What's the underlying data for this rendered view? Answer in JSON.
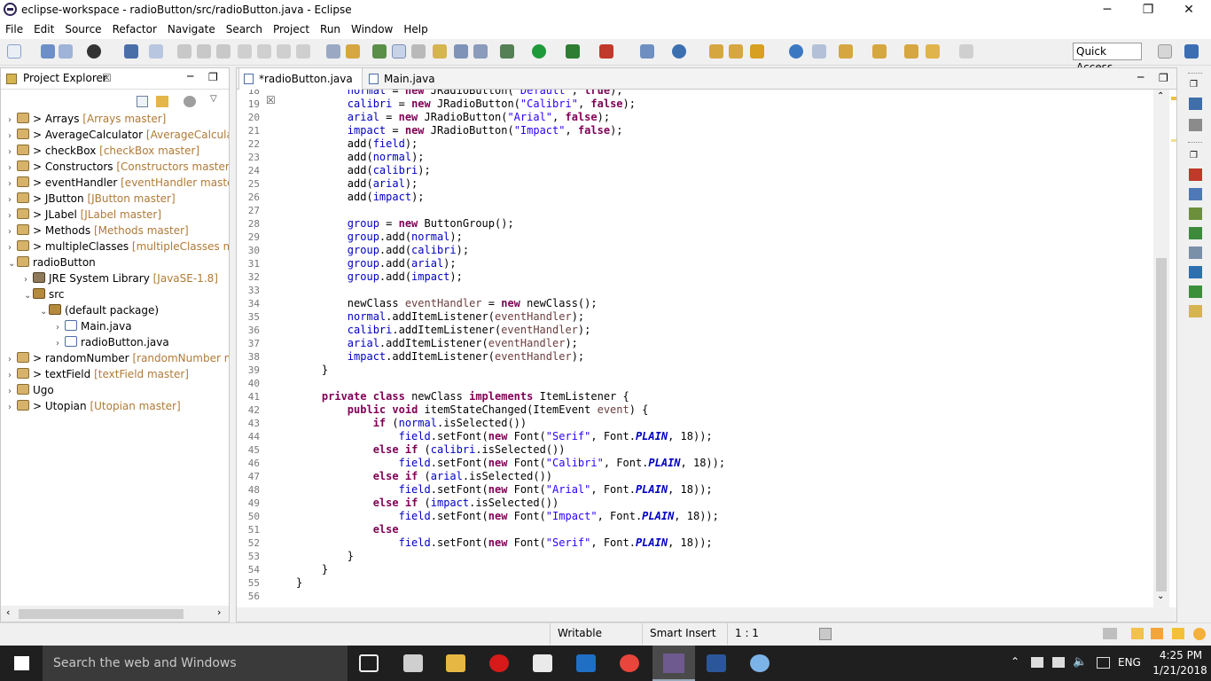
{
  "window": {
    "title": "eclipse-workspace - radioButton/src/radioButton.java - Eclipse",
    "minimize": "─",
    "maximize": "❐",
    "close": "✕"
  },
  "menu": [
    "File",
    "Edit",
    "Source",
    "Refactor",
    "Navigate",
    "Search",
    "Project",
    "Run",
    "Window",
    "Help"
  ],
  "quick_access": "Quick Access",
  "project_explorer": {
    "title": "Project Explorer",
    "tab_close": "☒",
    "items": [
      {
        "name": "> Arrays",
        "repo": "[Arrays master]",
        "depth": 0,
        "arrow": "›",
        "icon": "proj"
      },
      {
        "name": "> AverageCalculator",
        "repo": "[AverageCalculator",
        "depth": 0,
        "arrow": "›",
        "icon": "proj"
      },
      {
        "name": "> checkBox",
        "repo": "[checkBox master]",
        "depth": 0,
        "arrow": "›",
        "icon": "proj"
      },
      {
        "name": "> Constructors",
        "repo": "[Constructors master]",
        "depth": 0,
        "arrow": "›",
        "icon": "proj"
      },
      {
        "name": "> eventHandler",
        "repo": "[eventHandler master]",
        "depth": 0,
        "arrow": "›",
        "icon": "proj"
      },
      {
        "name": "> JButton",
        "repo": "[JButton master]",
        "depth": 0,
        "arrow": "›",
        "icon": "proj"
      },
      {
        "name": "> JLabel",
        "repo": "[JLabel master]",
        "depth": 0,
        "arrow": "›",
        "icon": "proj"
      },
      {
        "name": "> Methods",
        "repo": "[Methods master]",
        "depth": 0,
        "arrow": "›",
        "icon": "proj"
      },
      {
        "name": "> multipleClasses",
        "repo": "[multipleClasses mast",
        "depth": 0,
        "arrow": "›",
        "icon": "proj"
      },
      {
        "name": "radioButton",
        "repo": "",
        "depth": 0,
        "arrow": "⌄",
        "icon": "proj"
      },
      {
        "name": "JRE System Library",
        "repo": "[JavaSE-1.8]",
        "depth": 1,
        "arrow": "›",
        "icon": "lib"
      },
      {
        "name": "src",
        "repo": "",
        "depth": 1,
        "arrow": "⌄",
        "icon": "pkg"
      },
      {
        "name": "(default package)",
        "repo": "",
        "depth": 2,
        "arrow": "⌄",
        "icon": "pkg"
      },
      {
        "name": "Main.java",
        "repo": "",
        "depth": 3,
        "arrow": "›",
        "icon": "jfile"
      },
      {
        "name": "radioButton.java",
        "repo": "",
        "depth": 3,
        "arrow": "›",
        "icon": "jfile"
      },
      {
        "name": "> randomNumber",
        "repo": "[randomNumber ma",
        "depth": 0,
        "arrow": "›",
        "icon": "proj"
      },
      {
        "name": "> textField",
        "repo": "[textField master]",
        "depth": 0,
        "arrow": "›",
        "icon": "proj"
      },
      {
        "name": "Ugo",
        "repo": "",
        "depth": 0,
        "arrow": "›",
        "icon": "proj"
      },
      {
        "name": "> Utopian",
        "repo": "[Utopian master]",
        "depth": 0,
        "arrow": "›",
        "icon": "proj"
      }
    ]
  },
  "editor": {
    "tabs": [
      {
        "label": "*radioButton.java",
        "close": "☒"
      },
      {
        "label": "Main.java"
      }
    ],
    "lines": [
      {
        "n": "18",
        "h": "        <span class='fd'>normal</span> = <span class='kw'>new</span> JRadioButton(<span class='st'>\"Default\"</span>, <span class='kw'>true</span>);"
      },
      {
        "n": "19",
        "h": "        <span class='fd'>calibri</span> = <span class='kw'>new</span> JRadioButton(<span class='st'>\"Calibri\"</span>, <span class='kw'>false</span>);"
      },
      {
        "n": "20",
        "h": "        <span class='fd'>arial</span> = <span class='kw'>new</span> JRadioButton(<span class='st'>\"Arial\"</span>, <span class='kw'>false</span>);"
      },
      {
        "n": "21",
        "h": "        <span class='fd'>impact</span> = <span class='kw'>new</span> JRadioButton(<span class='st'>\"Impact\"</span>, <span class='kw'>false</span>);"
      },
      {
        "n": "22",
        "h": "        add(<span class='fd'>field</span>);"
      },
      {
        "n": "23",
        "h": "        add(<span class='fd'>normal</span>);"
      },
      {
        "n": "24",
        "h": "        add(<span class='fd'>calibri</span>);"
      },
      {
        "n": "25",
        "h": "        add(<span class='fd'>arial</span>);"
      },
      {
        "n": "26",
        "h": "        add(<span class='fd'>impact</span>);"
      },
      {
        "n": "27",
        "h": ""
      },
      {
        "n": "28",
        "h": "        <span class='fd'>group</span> = <span class='kw'>new</span> ButtonGroup();"
      },
      {
        "n": "29",
        "h": "        <span class='fd'>group</span>.add(<span class='fd'>normal</span>);"
      },
      {
        "n": "30",
        "h": "        <span class='fd'>group</span>.add(<span class='fd'>calibri</span>);"
      },
      {
        "n": "31",
        "h": "        <span class='fd'>group</span>.add(<span class='fd'>arial</span>);"
      },
      {
        "n": "32",
        "h": "        <span class='fd'>group</span>.add(<span class='fd'>impact</span>);"
      },
      {
        "n": "33",
        "h": ""
      },
      {
        "n": "34",
        "h": "        newClass <span class='vr'>eventHandler</span> = <span class='kw'>new</span> newClass();"
      },
      {
        "n": "35",
        "h": "        <span class='fd'>normal</span>.addItemListener(<span class='vr'>eventHandler</span>);"
      },
      {
        "n": "36",
        "h": "        <span class='fd'>calibri</span>.addItemListener(<span class='vr'>eventHandler</span>);"
      },
      {
        "n": "37",
        "h": "        <span class='fd'>arial</span>.addItemListener(<span class='vr'>eventHandler</span>);"
      },
      {
        "n": "38",
        "h": "        <span class='fd'>impact</span>.addItemListener(<span class='vr'>eventHandler</span>);"
      },
      {
        "n": "39",
        "h": "    }"
      },
      {
        "n": "40",
        "h": ""
      },
      {
        "n": "41",
        "h": "    <span class='kw'>private</span> <span class='kw'>class</span> newClass <span class='kw'>implements</span> ItemListener {"
      },
      {
        "n": "42",
        "h": "        <span class='kw'>public</span> <span class='kw'>void</span> itemStateChanged(ItemEvent <span class='vr'>event</span>) {"
      },
      {
        "n": "43",
        "h": "            <span class='kw'>if</span> (<span class='fd'>normal</span>.isSelected())"
      },
      {
        "n": "44",
        "h": "                <span class='fd'>field</span>.setFont(<span class='kw'>new</span> Font(<span class='st'>\"Serif\"</span>, Font.<span class='it'>PLAIN</span>, 18));"
      },
      {
        "n": "45",
        "h": "            <span class='kw'>else</span> <span class='kw'>if</span> (<span class='fd'>calibri</span>.isSelected())"
      },
      {
        "n": "46",
        "h": "                <span class='fd'>field</span>.setFont(<span class='kw'>new</span> Font(<span class='st'>\"Calibri\"</span>, Font.<span class='it'>PLAIN</span>, 18));"
      },
      {
        "n": "47",
        "h": "            <span class='kw'>else</span> <span class='kw'>if</span> (<span class='fd'>arial</span>.isSelected())"
      },
      {
        "n": "48",
        "h": "                <span class='fd'>field</span>.setFont(<span class='kw'>new</span> Font(<span class='st'>\"Arial\"</span>, Font.<span class='it'>PLAIN</span>, 18));"
      },
      {
        "n": "49",
        "h": "            <span class='kw'>else</span> <span class='kw'>if</span> (<span class='fd'>impact</span>.isSelected())"
      },
      {
        "n": "50",
        "h": "                <span class='fd'>field</span>.setFont(<span class='kw'>new</span> Font(<span class='st'>\"Impact\"</span>, Font.<span class='it'>PLAIN</span>, 18));"
      },
      {
        "n": "51",
        "h": "            <span class='kw'>else</span>"
      },
      {
        "n": "52",
        "h": "                <span class='fd'>field</span>.setFont(<span class='kw'>new</span> Font(<span class='st'>\"Serif\"</span>, Font.<span class='it'>PLAIN</span>, 18));"
      },
      {
        "n": "53",
        "h": "        }"
      },
      {
        "n": "54",
        "h": "    }"
      },
      {
        "n": "55",
        "h": "}"
      },
      {
        "n": "56",
        "h": ""
      }
    ]
  },
  "status": {
    "writable": "Writable",
    "insert_mode": "Smart Insert",
    "position": "1 : 1"
  },
  "taskbar": {
    "search": "Search the web and Windows",
    "language": "ENG",
    "time": "4:25 PM",
    "date": "1/21/2018"
  },
  "colors": {
    "keyword": "#7f0055",
    "string": "#2a00ff",
    "field": "#0000c0",
    "git_decoration": "#b07a36"
  }
}
